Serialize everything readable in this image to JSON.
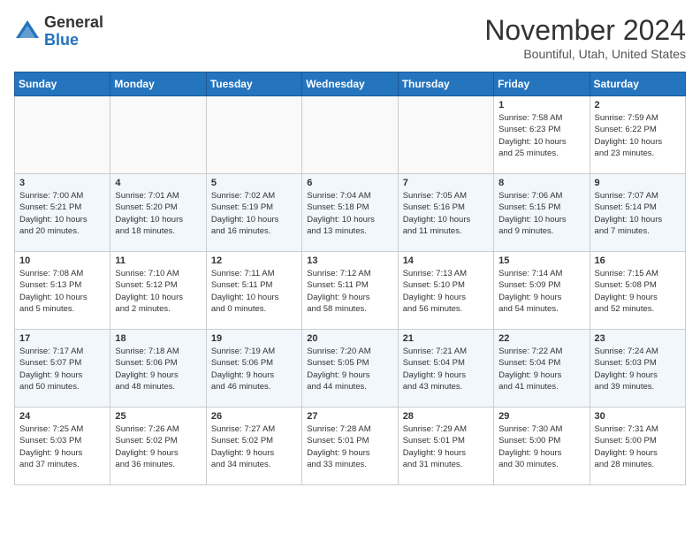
{
  "header": {
    "logo_general": "General",
    "logo_blue": "Blue",
    "month_title": "November 2024",
    "location": "Bountiful, Utah, United States"
  },
  "weekdays": [
    "Sunday",
    "Monday",
    "Tuesday",
    "Wednesday",
    "Thursday",
    "Friday",
    "Saturday"
  ],
  "weeks": [
    [
      {
        "day": "",
        "info": ""
      },
      {
        "day": "",
        "info": ""
      },
      {
        "day": "",
        "info": ""
      },
      {
        "day": "",
        "info": ""
      },
      {
        "day": "",
        "info": ""
      },
      {
        "day": "1",
        "info": "Sunrise: 7:58 AM\nSunset: 6:23 PM\nDaylight: 10 hours\nand 25 minutes."
      },
      {
        "day": "2",
        "info": "Sunrise: 7:59 AM\nSunset: 6:22 PM\nDaylight: 10 hours\nand 23 minutes."
      }
    ],
    [
      {
        "day": "3",
        "info": "Sunrise: 7:00 AM\nSunset: 5:21 PM\nDaylight: 10 hours\nand 20 minutes."
      },
      {
        "day": "4",
        "info": "Sunrise: 7:01 AM\nSunset: 5:20 PM\nDaylight: 10 hours\nand 18 minutes."
      },
      {
        "day": "5",
        "info": "Sunrise: 7:02 AM\nSunset: 5:19 PM\nDaylight: 10 hours\nand 16 minutes."
      },
      {
        "day": "6",
        "info": "Sunrise: 7:04 AM\nSunset: 5:18 PM\nDaylight: 10 hours\nand 13 minutes."
      },
      {
        "day": "7",
        "info": "Sunrise: 7:05 AM\nSunset: 5:16 PM\nDaylight: 10 hours\nand 11 minutes."
      },
      {
        "day": "8",
        "info": "Sunrise: 7:06 AM\nSunset: 5:15 PM\nDaylight: 10 hours\nand 9 minutes."
      },
      {
        "day": "9",
        "info": "Sunrise: 7:07 AM\nSunset: 5:14 PM\nDaylight: 10 hours\nand 7 minutes."
      }
    ],
    [
      {
        "day": "10",
        "info": "Sunrise: 7:08 AM\nSunset: 5:13 PM\nDaylight: 10 hours\nand 5 minutes."
      },
      {
        "day": "11",
        "info": "Sunrise: 7:10 AM\nSunset: 5:12 PM\nDaylight: 10 hours\nand 2 minutes."
      },
      {
        "day": "12",
        "info": "Sunrise: 7:11 AM\nSunset: 5:11 PM\nDaylight: 10 hours\nand 0 minutes."
      },
      {
        "day": "13",
        "info": "Sunrise: 7:12 AM\nSunset: 5:11 PM\nDaylight: 9 hours\nand 58 minutes."
      },
      {
        "day": "14",
        "info": "Sunrise: 7:13 AM\nSunset: 5:10 PM\nDaylight: 9 hours\nand 56 minutes."
      },
      {
        "day": "15",
        "info": "Sunrise: 7:14 AM\nSunset: 5:09 PM\nDaylight: 9 hours\nand 54 minutes."
      },
      {
        "day": "16",
        "info": "Sunrise: 7:15 AM\nSunset: 5:08 PM\nDaylight: 9 hours\nand 52 minutes."
      }
    ],
    [
      {
        "day": "17",
        "info": "Sunrise: 7:17 AM\nSunset: 5:07 PM\nDaylight: 9 hours\nand 50 minutes."
      },
      {
        "day": "18",
        "info": "Sunrise: 7:18 AM\nSunset: 5:06 PM\nDaylight: 9 hours\nand 48 minutes."
      },
      {
        "day": "19",
        "info": "Sunrise: 7:19 AM\nSunset: 5:06 PM\nDaylight: 9 hours\nand 46 minutes."
      },
      {
        "day": "20",
        "info": "Sunrise: 7:20 AM\nSunset: 5:05 PM\nDaylight: 9 hours\nand 44 minutes."
      },
      {
        "day": "21",
        "info": "Sunrise: 7:21 AM\nSunset: 5:04 PM\nDaylight: 9 hours\nand 43 minutes."
      },
      {
        "day": "22",
        "info": "Sunrise: 7:22 AM\nSunset: 5:04 PM\nDaylight: 9 hours\nand 41 minutes."
      },
      {
        "day": "23",
        "info": "Sunrise: 7:24 AM\nSunset: 5:03 PM\nDaylight: 9 hours\nand 39 minutes."
      }
    ],
    [
      {
        "day": "24",
        "info": "Sunrise: 7:25 AM\nSunset: 5:03 PM\nDaylight: 9 hours\nand 37 minutes."
      },
      {
        "day": "25",
        "info": "Sunrise: 7:26 AM\nSunset: 5:02 PM\nDaylight: 9 hours\nand 36 minutes."
      },
      {
        "day": "26",
        "info": "Sunrise: 7:27 AM\nSunset: 5:02 PM\nDaylight: 9 hours\nand 34 minutes."
      },
      {
        "day": "27",
        "info": "Sunrise: 7:28 AM\nSunset: 5:01 PM\nDaylight: 9 hours\nand 33 minutes."
      },
      {
        "day": "28",
        "info": "Sunrise: 7:29 AM\nSunset: 5:01 PM\nDaylight: 9 hours\nand 31 minutes."
      },
      {
        "day": "29",
        "info": "Sunrise: 7:30 AM\nSunset: 5:00 PM\nDaylight: 9 hours\nand 30 minutes."
      },
      {
        "day": "30",
        "info": "Sunrise: 7:31 AM\nSunset: 5:00 PM\nDaylight: 9 hours\nand 28 minutes."
      }
    ]
  ]
}
